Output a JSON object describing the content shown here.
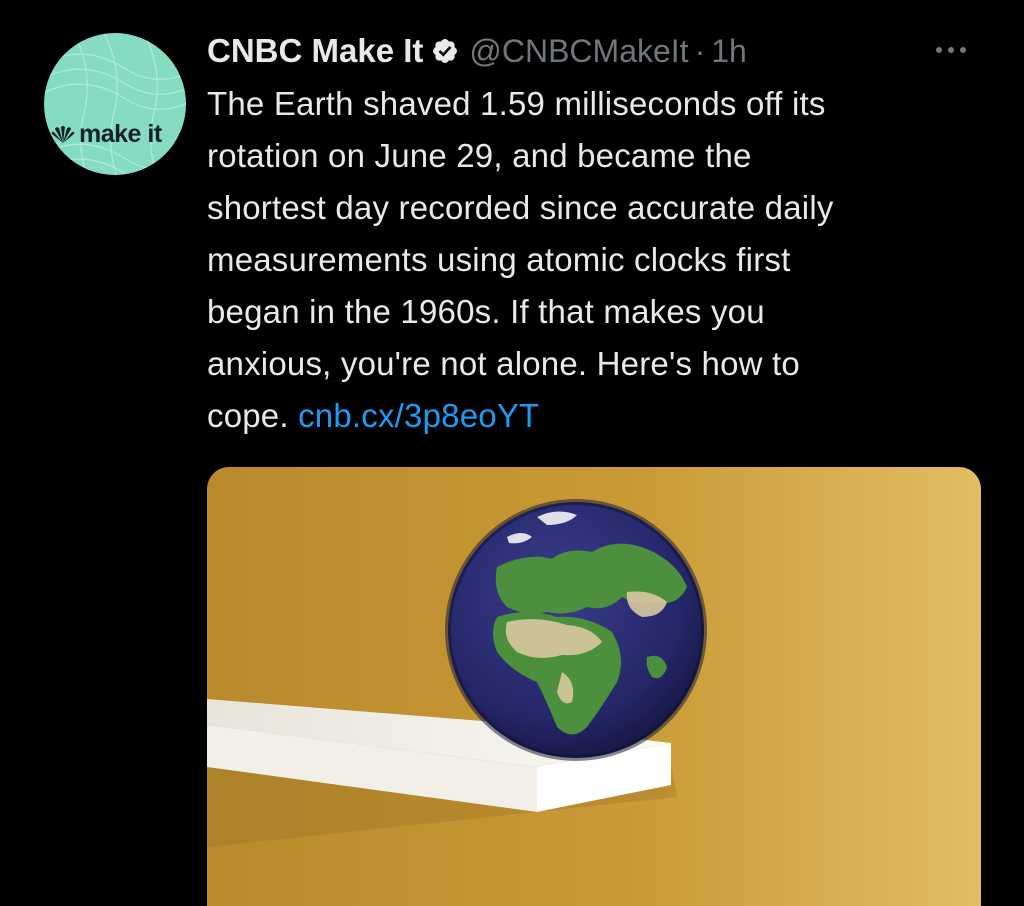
{
  "tweet": {
    "display_name": "CNBC Make It",
    "handle": "@CNBCMakeIt",
    "separator": "·",
    "time": "1h",
    "avatar_logo_text": "make it",
    "text_lines": [
      "The Earth shaved 1.59 milliseconds off its",
      "rotation on June 29, and became the",
      "shortest day recorded since accurate daily",
      "measurements using atomic clocks first",
      "began in the 1960s. If that makes you",
      "anxious, you're not alone. Here's how to"
    ],
    "last_line_text": "cope.",
    "link_text": "cnb.cx/3p8eoYT",
    "icons": {
      "verified": "verified-badge-icon",
      "more": "more-options-icon",
      "logo": "nbc-peacock-icon"
    }
  },
  "colors": {
    "background": "#000000",
    "text": "#e7e9ea",
    "secondary": "#71767b",
    "link": "#1d9bf0",
    "avatar": "#86dcc3",
    "media_background": "#c9962e"
  }
}
